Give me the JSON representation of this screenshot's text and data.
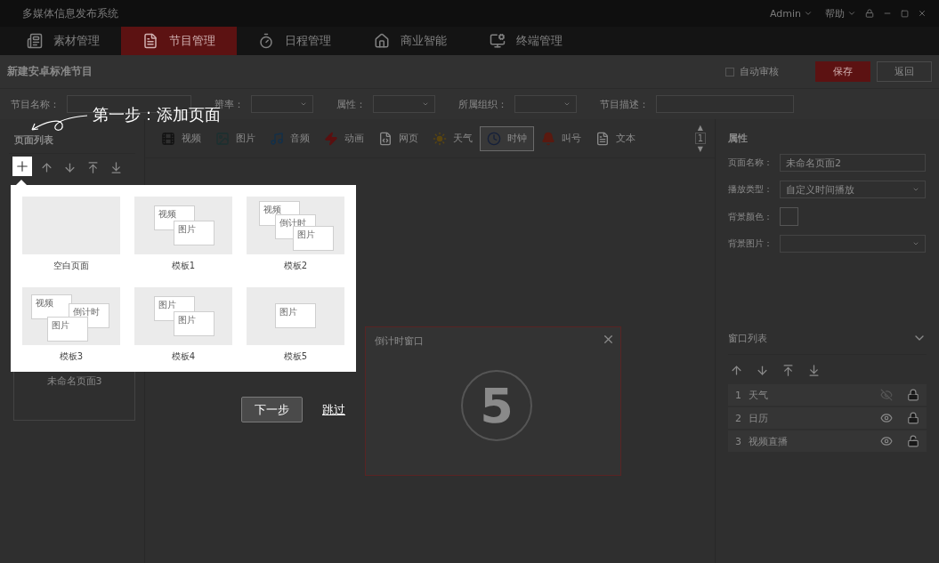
{
  "app": {
    "title": "多媒体信息发布系统",
    "user": "Admin",
    "help": "帮助"
  },
  "nav": [
    {
      "label": "素材管理",
      "kind": "media",
      "selected": false
    },
    {
      "label": "节目管理",
      "kind": "program",
      "selected": true
    },
    {
      "label": "日程管理",
      "kind": "schedule",
      "selected": false
    },
    {
      "label": "商业智能",
      "kind": "business",
      "selected": false
    },
    {
      "label": "终端管理",
      "kind": "terminal",
      "selected": false
    }
  ],
  "header": {
    "title": "新建安卓标准节目",
    "auto_review": {
      "label": "自动审核",
      "checked": false
    },
    "buttons": [
      {
        "label": "保存",
        "kind": "primary"
      },
      {
        "label": "返回",
        "kind": "default"
      }
    ]
  },
  "filters": [
    {
      "label": "节目名称：",
      "kind": "input"
    },
    {
      "label": "辨率：",
      "kind": "select"
    },
    {
      "label": "属性：",
      "kind": "select"
    },
    {
      "label": "所属组织：",
      "kind": "select"
    },
    {
      "label": "节目描述：",
      "kind": "input"
    }
  ],
  "page_list": {
    "title": "页面列表",
    "pages": [
      {
        "label": "未命名页面3"
      }
    ]
  },
  "media_tools": [
    {
      "label": "视频",
      "kind": "video",
      "selected": false
    },
    {
      "label": "图片",
      "kind": "image",
      "selected": false
    },
    {
      "label": "音频",
      "kind": "audio",
      "selected": false
    },
    {
      "label": "动画",
      "kind": "flash",
      "selected": false
    },
    {
      "label": "网页",
      "kind": "web",
      "selected": false
    },
    {
      "label": "天气",
      "kind": "weather",
      "selected": false
    },
    {
      "label": "时钟",
      "kind": "clock",
      "selected": true
    },
    {
      "label": "叫号",
      "kind": "bell",
      "selected": false
    },
    {
      "label": "文本",
      "kind": "text",
      "selected": false
    }
  ],
  "page_counter": {
    "up": "▲",
    "value": "1",
    "down": "▼"
  },
  "canvas": {
    "window": {
      "title": "倒计时窗口",
      "count": "5"
    }
  },
  "guide": {
    "step": "第一步：添加页面",
    "next": "下一步",
    "skip": "跳过",
    "templates": [
      {
        "label": "空白页面",
        "kind": "blank"
      },
      {
        "label": "模板1",
        "kind": "pair",
        "boxes": [
          "视频",
          "图片"
        ]
      },
      {
        "label": "模板2",
        "kind": "cascade",
        "boxes": [
          "视频",
          "倒计时",
          "图片"
        ]
      },
      {
        "label": "模板3",
        "kind": "trio",
        "boxes": [
          "视频",
          "倒计时",
          "图片"
        ]
      },
      {
        "label": "模板4",
        "kind": "pair",
        "boxes": [
          "图片",
          "图片"
        ]
      },
      {
        "label": "模板5",
        "kind": "single",
        "boxes": [
          "图片"
        ]
      }
    ]
  },
  "properties": {
    "title": "属性",
    "fields": [
      {
        "label": "页面名称：",
        "value": "未命名页面2",
        "kind": "input"
      },
      {
        "label": "播放类型：",
        "value": "自定义时间播放",
        "kind": "select"
      },
      {
        "label": "背景颜色：",
        "kind": "color"
      },
      {
        "label": "背景图片：",
        "kind": "select"
      }
    ]
  },
  "window_list": {
    "title": "窗口列表",
    "expanded": true,
    "items": [
      {
        "index": "1",
        "name": "天气",
        "visible": false,
        "locked": true
      },
      {
        "index": "2",
        "name": "日历",
        "visible": true,
        "locked": true
      },
      {
        "index": "3",
        "name": "视频直播",
        "visible": true,
        "locked": false
      }
    ]
  }
}
